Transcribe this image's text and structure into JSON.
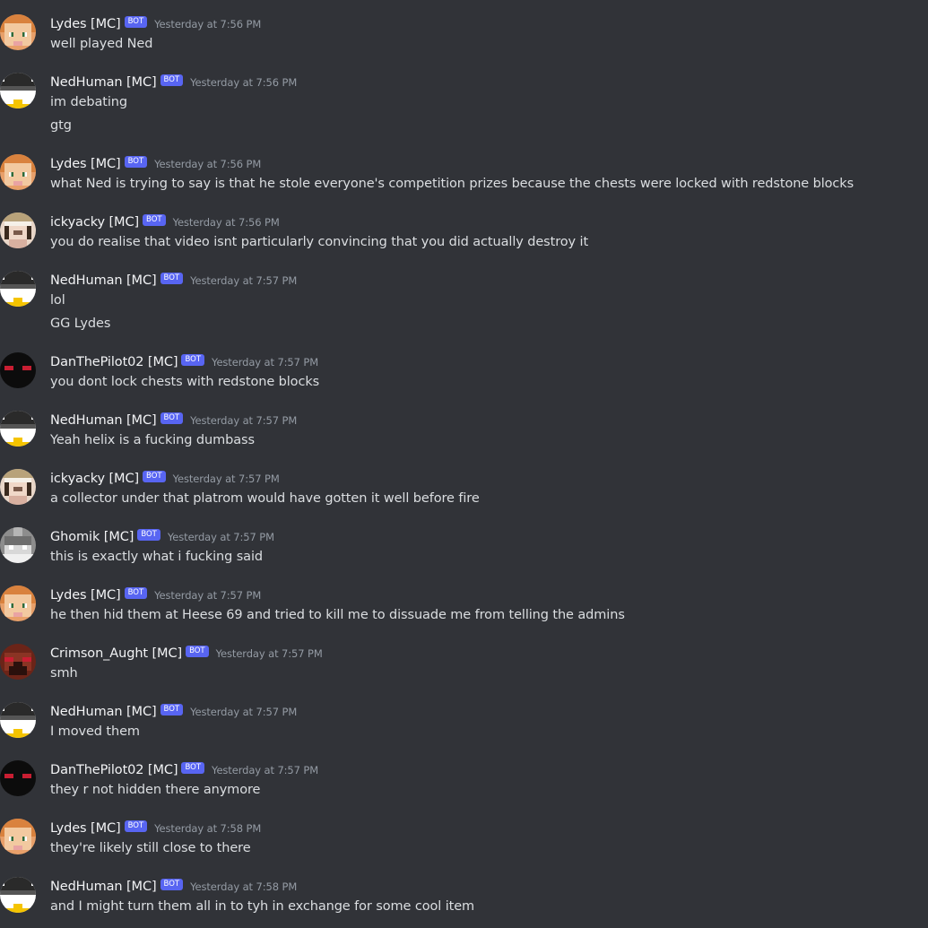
{
  "bot_tag": "BOT",
  "colors": {
    "background": "#313338",
    "username": "#f2f3f5",
    "message_text": "#dbdee1",
    "timestamp": "#949ba4",
    "bot_tag_bg": "#5865f2"
  },
  "messages": [
    {
      "author": "Lydes [MC]",
      "avatar": "lydes",
      "timestamp": "Yesterday at 7:56 PM",
      "lines": [
        "well played Ned"
      ]
    },
    {
      "author": "NedHuman [MC]",
      "avatar": "nedhuman",
      "timestamp": "Yesterday at 7:56 PM",
      "lines": [
        "im debating",
        "gtg"
      ]
    },
    {
      "author": "Lydes [MC]",
      "avatar": "lydes",
      "timestamp": "Yesterday at 7:56 PM",
      "lines": [
        "what Ned is trying to say is that he stole everyone's competition prizes because the chests were locked with redstone blocks"
      ]
    },
    {
      "author": "ickyacky [MC]",
      "avatar": "ickyacky",
      "timestamp": "Yesterday at 7:56 PM",
      "lines": [
        "you do realise that video isnt particularly convincing that you did actually destroy it"
      ]
    },
    {
      "author": "NedHuman [MC]",
      "avatar": "nedhuman",
      "timestamp": "Yesterday at 7:57 PM",
      "lines": [
        "lol",
        "GG Lydes"
      ]
    },
    {
      "author": "DanThePilot02 [MC]",
      "avatar": "danthepilot",
      "timestamp": "Yesterday at 7:57 PM",
      "lines": [
        "you dont lock chests with redstone blocks"
      ]
    },
    {
      "author": "NedHuman [MC]",
      "avatar": "nedhuman",
      "timestamp": "Yesterday at 7:57 PM",
      "lines": [
        "Yeah helix is a fucking dumbass"
      ]
    },
    {
      "author": "ickyacky [MC]",
      "avatar": "ickyacky",
      "timestamp": "Yesterday at 7:57 PM",
      "lines": [
        "a collector under that platrom would have gotten it well before fire"
      ]
    },
    {
      "author": "Ghomik [MC]",
      "avatar": "ghomik",
      "timestamp": "Yesterday at 7:57 PM",
      "lines": [
        "this is exactly what i fucking said"
      ]
    },
    {
      "author": "Lydes [MC]",
      "avatar": "lydes",
      "timestamp": "Yesterday at 7:57 PM",
      "lines": [
        "he then hid them at Heese 69 and tried to kill me to dissuade me from telling the admins"
      ]
    },
    {
      "author": "Crimson_Aught [MC]",
      "avatar": "crimson",
      "timestamp": "Yesterday at 7:57 PM",
      "lines": [
        "smh"
      ]
    },
    {
      "author": "NedHuman [MC]",
      "avatar": "nedhuman",
      "timestamp": "Yesterday at 7:57 PM",
      "lines": [
        "I moved them"
      ]
    },
    {
      "author": "DanThePilot02 [MC]",
      "avatar": "danthepilot",
      "timestamp": "Yesterday at 7:57 PM",
      "lines": [
        "they r not hidden there anymore"
      ]
    },
    {
      "author": "Lydes [MC]",
      "avatar": "lydes",
      "timestamp": "Yesterday at 7:58 PM",
      "lines": [
        "they're likely still close to there"
      ]
    },
    {
      "author": "NedHuman [MC]",
      "avatar": "nedhuman",
      "timestamp": "Yesterday at 7:58 PM",
      "lines": [
        "and I might turn them all in to tyh in exchange for some cool item"
      ]
    }
  ]
}
